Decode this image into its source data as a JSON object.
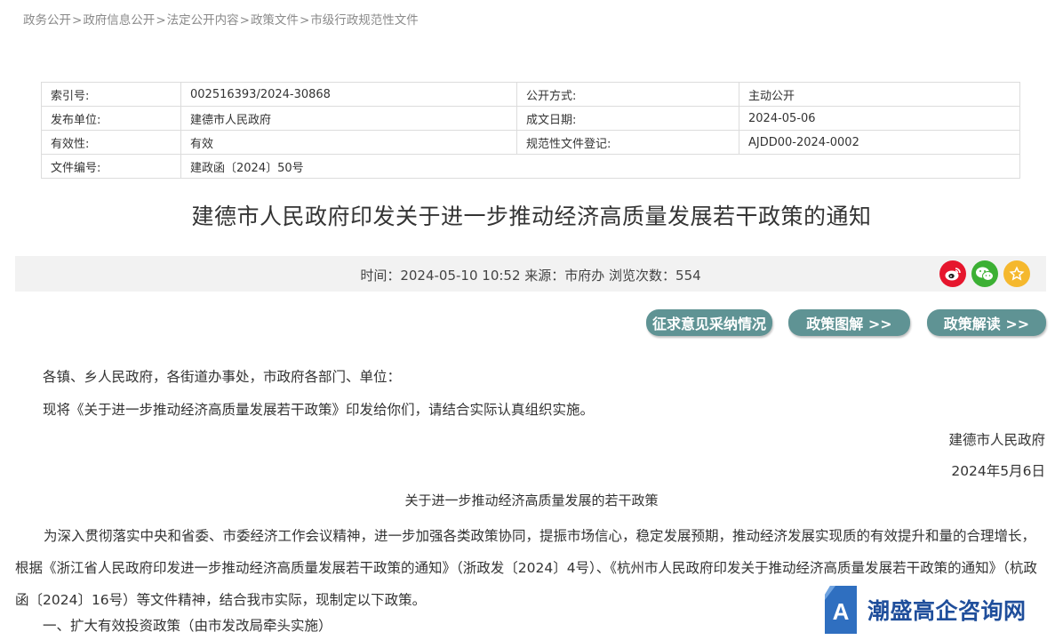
{
  "breadcrumb": [
    "政务公开",
    "政府信息公开",
    "法定公开内容",
    "政策文件",
    "市级行政规范性文件"
  ],
  "meta": {
    "rows": [
      {
        "k1": "索引号:",
        "v1": "002516393/2024-30868",
        "k2": "公开方式:",
        "v2": "主动公开"
      },
      {
        "k1": "发布单位:",
        "v1": "建德市人民政府",
        "k2": "成文日期:",
        "v2": "2024-05-06"
      },
      {
        "k1": "有效性:",
        "v1": "有效",
        "k2": "规范性文件登记:",
        "v2": "AJDD00-2024-0002"
      },
      {
        "k1": "文件编号:",
        "v1": "建政函〔2024〕50号"
      }
    ]
  },
  "title": "建德市人民政府印发关于进一步推动经济高质量发展若干政策的通知",
  "info_bar": {
    "text": "时间：2024-05-10 10:52 来源：市府办 浏览次数：554",
    "share_icons": [
      "weibo-icon",
      "wechat-icon",
      "star-icon"
    ]
  },
  "buttons": {
    "feedback": "征求意见采纳情况",
    "graphic": "政策图解 >>",
    "interpret": "政策解读 >>"
  },
  "content": {
    "salutation": "各镇、乡人民政府，各街道办事处，市政府各部门、单位：",
    "line2": "现将《关于进一步推动经济高质量发展若干政策》印发给你们，请结合实际认真组织实施。",
    "sign_org": "建德市人民政府",
    "sign_date": "2024年5月6日",
    "sub_title": "关于进一步推动经济高质量发展的若干政策",
    "paragraph": "为深入贯彻落实中央和省委、市委经济工作会议精神，进一步加强各类政策协同，提振市场信心，稳定发展预期，推动经济发展实现质的有效提升和量的合理增长，根据《浙江省人民政府印发进一步推动经济高质量发展若干政策的通知》（浙政发〔2024〕4号）、《杭州市人民政府印发关于推动经济高质量发展若干政策的通知》（杭政函〔2024〕16号）等文件精神，结合我市实际，现制定以下政策。",
    "section1": "一、扩大有效投资政策（由市发改局牵头实施）"
  },
  "watermark": {
    "logo_letter": "A",
    "text": "潮盛高企咨询网"
  },
  "colors": {
    "button_bg": "#5f9394",
    "info_bar_bg": "#f2f2f2",
    "weibo": "#e6162d",
    "wechat": "#3cb034",
    "favorite": "#f5b82e",
    "watermark": "#1f4e9b"
  }
}
